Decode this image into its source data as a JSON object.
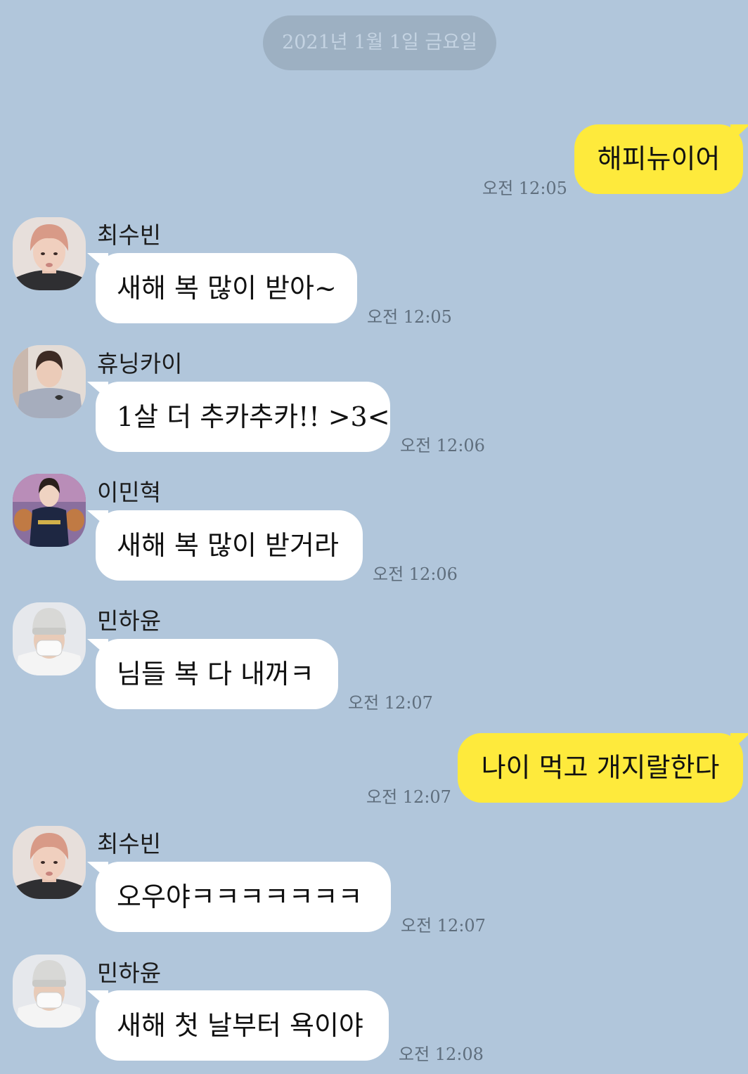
{
  "date_divider": "2021년 1월 1일 금요일",
  "messages": [
    {
      "side": "out",
      "text": "해피뉴이어",
      "time": "오전 12:05"
    },
    {
      "side": "in",
      "sender": "최수빈",
      "avatar": "avatar-pink-hair",
      "text": "새해 복 많이 받아~",
      "time": "오전 12:05"
    },
    {
      "side": "in",
      "sender": "휴닝카이",
      "avatar": "avatar-gray-sweater",
      "text": "1살 더 추카추카!! >3<",
      "time": "오전 12:06"
    },
    {
      "side": "in",
      "sender": "이민혁",
      "avatar": "avatar-navy-sweater",
      "text": "새해 복 많이 받거라",
      "time": "오전 12:06"
    },
    {
      "side": "in",
      "sender": "민하윤",
      "avatar": "avatar-mask-beanie",
      "text": "님들 복 다 내꺼ㅋ",
      "time": "오전 12:07"
    },
    {
      "side": "out",
      "text": "나이 먹고 개지랄한다",
      "time": "오전 12:07"
    },
    {
      "side": "in",
      "sender": "최수빈",
      "avatar": "avatar-pink-hair",
      "text": "오우야ㅋㅋㅋㅋㅋㅋㅋ",
      "time": "오전 12:07"
    },
    {
      "side": "in",
      "sender": "민하윤",
      "avatar": "avatar-mask-beanie",
      "text": "새해 첫 날부터 욕이야",
      "time": "오전 12:08"
    }
  ],
  "colors": {
    "background": "#B1C6DB",
    "outgoing_bubble": "#FEEA3C",
    "incoming_bubble": "#FFFFFF",
    "date_pill": "#9DB0C2",
    "timestamp": "#5F6E7D"
  }
}
